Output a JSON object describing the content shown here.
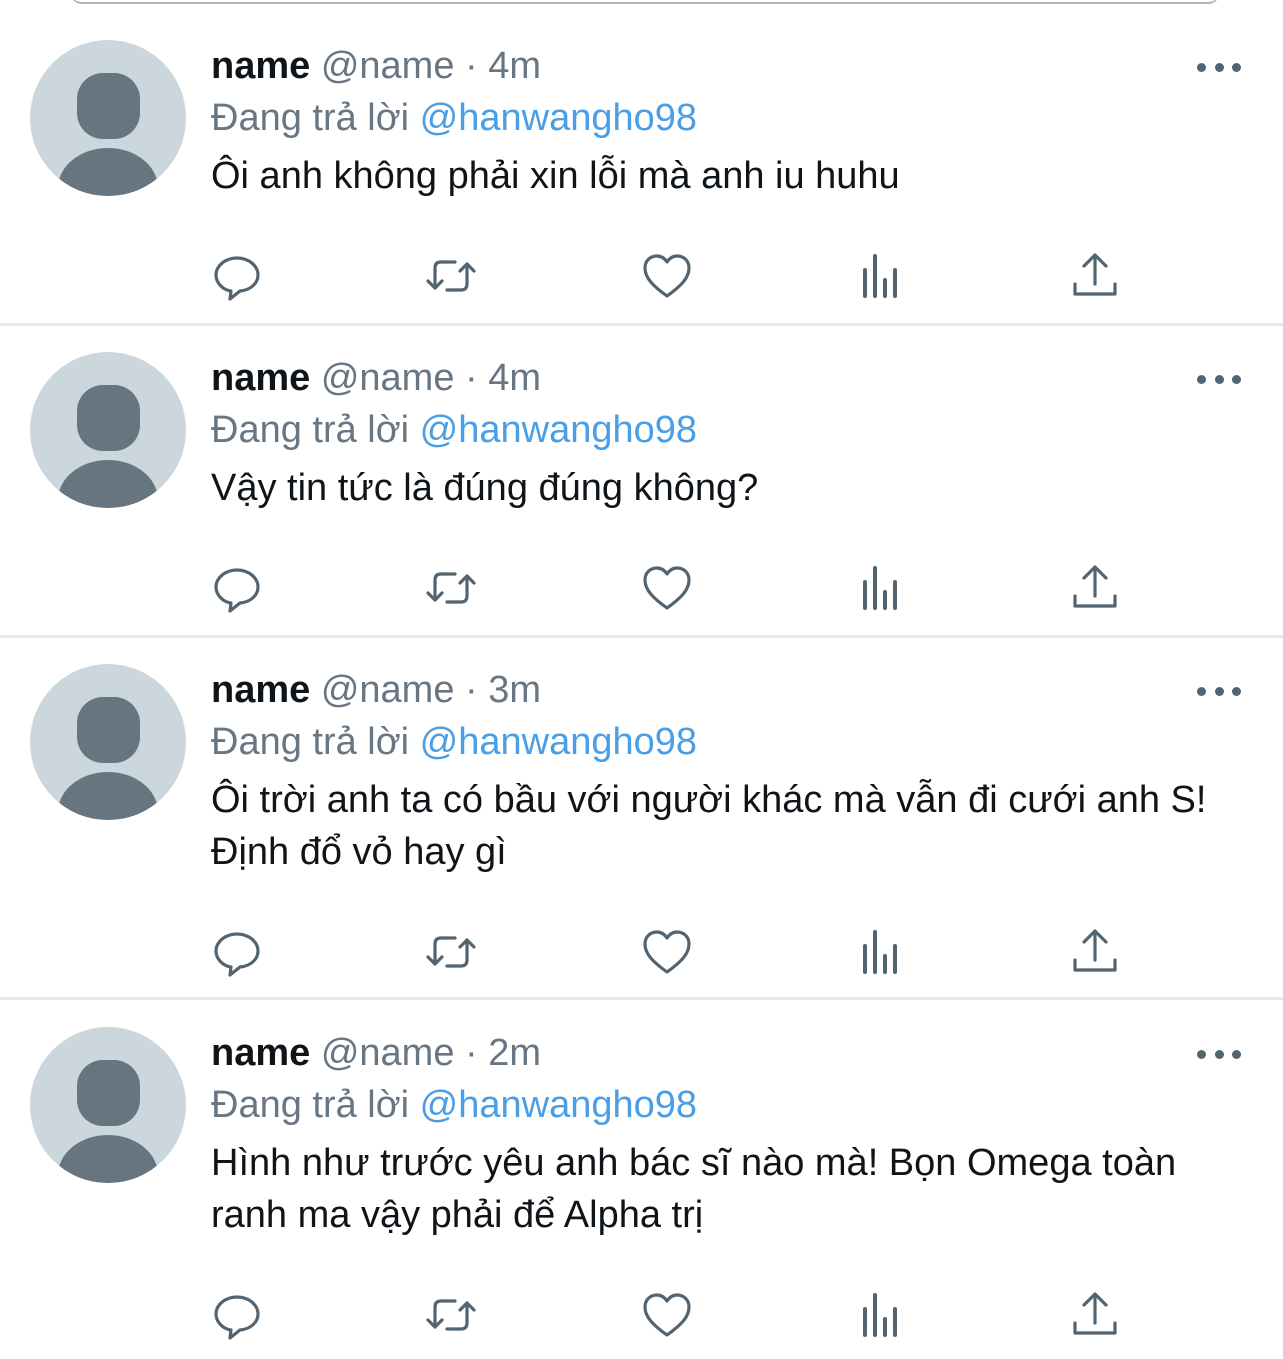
{
  "reply_prefix": "Đang trả lời",
  "tweets": [
    {
      "display_name": "name",
      "handle": "@name",
      "separator": "·",
      "time": "4m",
      "reply_to": "@hanwangho98",
      "text": "Ôi anh không phải xin lỗi mà anh iu huhu"
    },
    {
      "display_name": "name",
      "handle": "@name",
      "separator": "·",
      "time": "4m",
      "reply_to": "@hanwangho98",
      "text": "Vậy tin tức là đúng đúng không?"
    },
    {
      "display_name": "name",
      "handle": "@name",
      "separator": "·",
      "time": "3m",
      "reply_to": "@hanwangho98",
      "text": "Ôi trời anh ta có bầu với người khác mà vẫn đi cưới anh S! Định đổ vỏ hay gì"
    },
    {
      "display_name": "name",
      "handle": "@name",
      "separator": "·",
      "time": "2m",
      "reply_to": "@hanwangho98",
      "text": "Hình như trước yêu anh bác sĩ nào mà! Bọn Omega toàn ranh ma vậy phải để Alpha trị"
    }
  ],
  "icons": {
    "reply": "reply-icon",
    "retweet": "retweet-icon",
    "like": "like-icon",
    "analytics": "analytics-icon",
    "share": "share-icon",
    "more": "more-options-icon"
  },
  "colors": {
    "link": "#4a9ee6",
    "secondary_text": "#687684",
    "icon": "#536471",
    "avatar_bg": "#ccd6dd",
    "avatar_fg": "#66757f",
    "divider": "#e6e9eb"
  }
}
